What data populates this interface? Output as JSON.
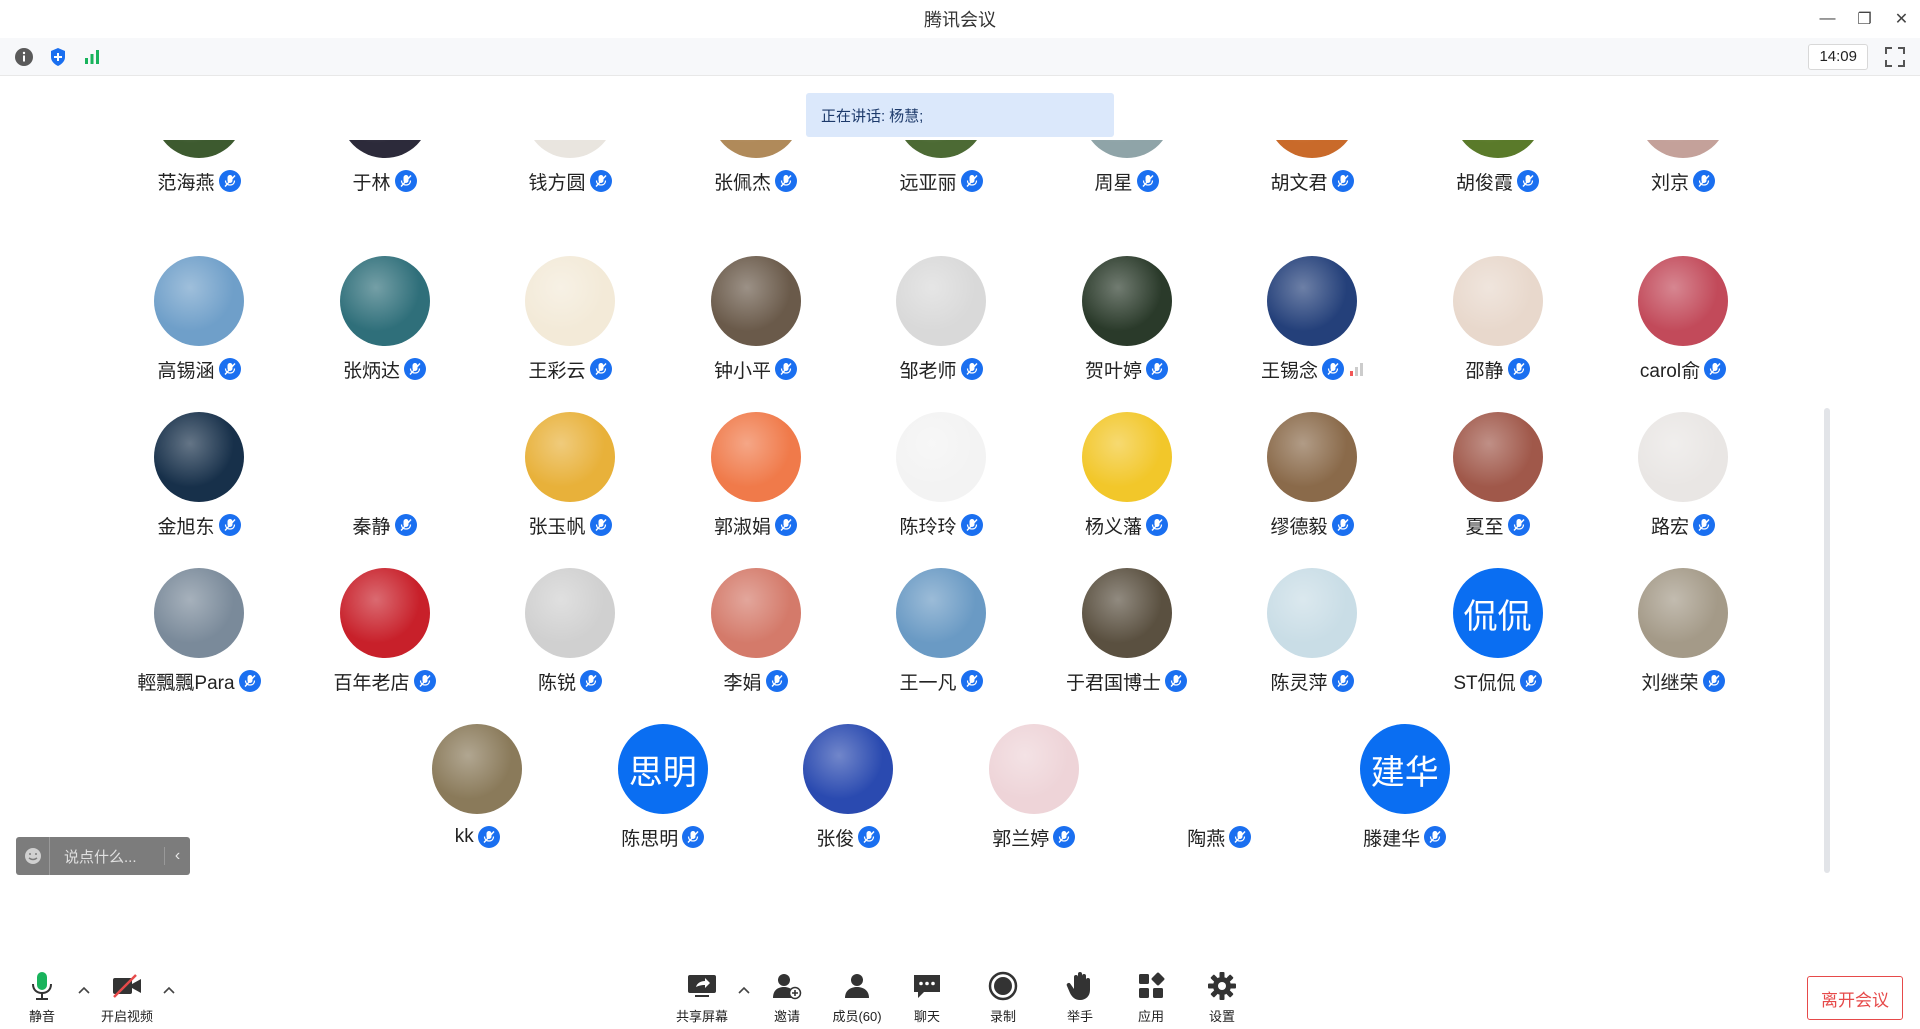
{
  "window": {
    "title": "腾讯会议",
    "minimize": "—",
    "restore": "❐",
    "close": "✕"
  },
  "infobar": {
    "clock": "14:09"
  },
  "speaking": {
    "label": "正在讲话:",
    "speaker": "杨慧;"
  },
  "participants": [
    {
      "name": "范海燕",
      "avatar": "pic",
      "bg": "#3d5a2f"
    },
    {
      "name": "于林",
      "avatar": "pic",
      "bg": "#2c2a3a"
    },
    {
      "name": "钱方圆",
      "avatar": "pic",
      "bg": "#e9e5df"
    },
    {
      "name": "张佩杰",
      "avatar": "pic",
      "bg": "#b08a5a"
    },
    {
      "name": "远亚丽",
      "avatar": "pic",
      "bg": "#4c6a34"
    },
    {
      "name": "周星",
      "avatar": "pic",
      "bg": "#8fa4a8"
    },
    {
      "name": "胡文君",
      "avatar": "pic",
      "bg": "#c96a2a"
    },
    {
      "name": "胡俊霞",
      "avatar": "pic",
      "bg": "#5a7a2a"
    },
    {
      "name": "刘京",
      "avatar": "pic",
      "bg": "#c4a19a"
    },
    {
      "name": "高锡涵",
      "avatar": "pic",
      "bg": "#6f9fc9"
    },
    {
      "name": "张炳达",
      "avatar": "pic",
      "bg": "#2f6f7a"
    },
    {
      "name": "王彩云",
      "avatar": "pic",
      "bg": "#f3ead8"
    },
    {
      "name": "钟小平",
      "avatar": "pic",
      "bg": "#6a5a4a"
    },
    {
      "name": "邹老师",
      "avatar": "pic",
      "bg": "#d9d9d9"
    },
    {
      "name": "贺叶婷",
      "avatar": "pic",
      "bg": "#2a3a2a"
    },
    {
      "name": "王锡念",
      "avatar": "pic",
      "bg": "#24407a"
    },
    {
      "name": "邵静",
      "avatar": "pic",
      "bg": "#e8d8cc"
    },
    {
      "name": "carol俞",
      "avatar": "pic",
      "bg": "#c24a5a"
    },
    {
      "name": "金旭东",
      "avatar": "pic",
      "bg": "#17304a"
    },
    {
      "name": "秦静",
      "avatar": "pic",
      "bg": "#ffffff"
    },
    {
      "name": "张玉帆",
      "avatar": "pic",
      "bg": "#e8b13a"
    },
    {
      "name": "郭淑娟",
      "avatar": "pic",
      "bg": "#f07a4a"
    },
    {
      "name": "陈玲玲",
      "avatar": "pic",
      "bg": "#f3f3f3"
    },
    {
      "name": "杨义藩",
      "avatar": "pic",
      "bg": "#f2c72a"
    },
    {
      "name": "缪德毅",
      "avatar": "pic",
      "bg": "#8a6a4a"
    },
    {
      "name": "夏至",
      "avatar": "pic",
      "bg": "#a0584a"
    },
    {
      "name": "路宏",
      "avatar": "pic",
      "bg": "#e9e6e4"
    },
    {
      "name": "輕飄飄Para",
      "avatar": "pic",
      "bg": "#7a8a9a"
    },
    {
      "name": "百年老店",
      "avatar": "pic",
      "bg": "#c8202a"
    },
    {
      "name": "陈锐",
      "avatar": "pic",
      "bg": "#d0d0d0"
    },
    {
      "name": "李娟",
      "avatar": "pic",
      "bg": "#d47a6a"
    },
    {
      "name": "王一凡",
      "avatar": "pic",
      "bg": "#6a9ac4"
    },
    {
      "name": "于君国博士",
      "avatar": "pic",
      "bg": "#5a5040"
    },
    {
      "name": "陈灵萍",
      "avatar": "pic",
      "bg": "#c9dde6"
    },
    {
      "name": "ST侃侃",
      "avatar": "text",
      "initials": "侃侃"
    },
    {
      "name": "刘继荣",
      "avatar": "pic",
      "bg": "#a49a88"
    },
    {
      "name": "kk",
      "avatar": "pic",
      "bg": "#8a7a5a"
    },
    {
      "name": "陈思明",
      "avatar": "text",
      "initials": "思明"
    },
    {
      "name": "张俊",
      "avatar": "pic",
      "bg": "#2a4ab0"
    },
    {
      "name": "郭兰婷",
      "avatar": "pic",
      "bg": "#eed4d8"
    },
    {
      "name": "陶燕",
      "avatar": "pic",
      "bg": "#ffffff"
    },
    {
      "name": "滕建华",
      "avatar": "text",
      "initials": "建华"
    }
  ],
  "chat": {
    "placeholder": "说点什么..."
  },
  "toolbar": {
    "mute": "静音",
    "video": "开启视频",
    "share": "共享屏幕",
    "invite": "邀请",
    "members": "成员(60)",
    "chat": "聊天",
    "record": "录制",
    "hand": "举手",
    "apps": "应用",
    "settings": "设置",
    "leave": "离开会议"
  },
  "colors": {
    "accent": "#1a6ff0",
    "leave": "#e64a4a",
    "mic_on": "#19b35c"
  }
}
